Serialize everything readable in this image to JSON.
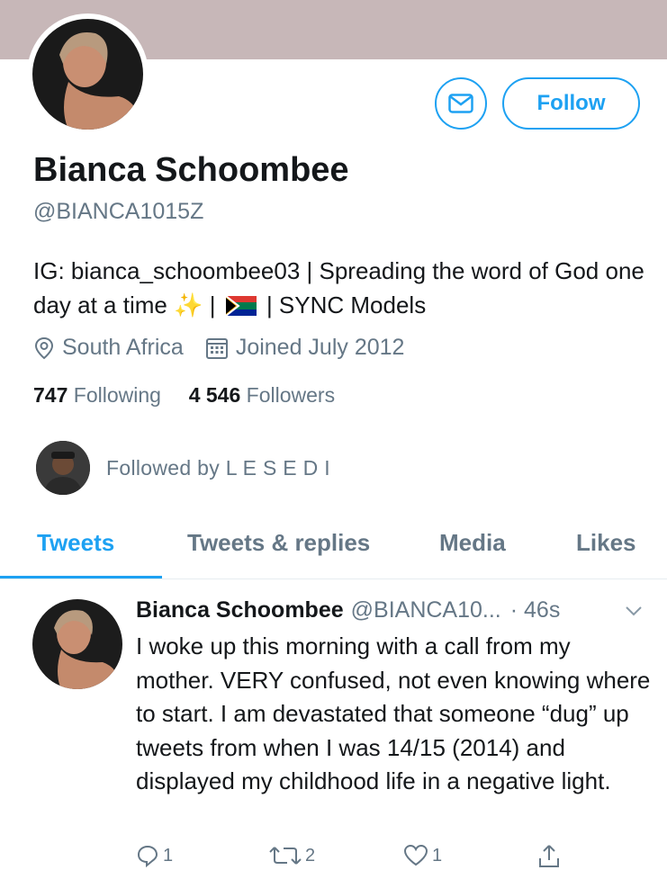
{
  "profile": {
    "display_name": "Bianca Schoombee",
    "handle": "@BIANCA1015Z",
    "bio_part1": "IG: bianca_schoombee03 | Spreading the word of God one day at a time",
    "bio_sparkle": "✨",
    "bio_sep1": "|",
    "bio_flag": "south-africa-flag",
    "bio_part2": "| SYNC Models",
    "location": "South Africa",
    "joined": "Joined July 2012",
    "following_count": "747",
    "following_label": "Following",
    "followers_count": "4 546",
    "followers_label": "Followers",
    "followed_by": "Followed by L E S E D I"
  },
  "buttons": {
    "follow_label": "Follow",
    "message_icon": "envelope-icon"
  },
  "tabs": [
    {
      "label": "Tweets",
      "active": true
    },
    {
      "label": "Tweets & replies",
      "active": false
    },
    {
      "label": "Media",
      "active": false
    },
    {
      "label": "Likes",
      "active": false
    }
  ],
  "tweet": {
    "author_name": "Bianca Schoombee",
    "author_handle": "@BIANCA10...",
    "time": "· 46s",
    "text": "I woke up this morning with a call from my mother. VERY confused, not even knowing where to start. I am devastated that someone “dug” up tweets from when I was 14/15 (2014) and displayed my childhood life in a negative light.",
    "reply_count": "1",
    "retweet_count": "2",
    "like_count": "1"
  },
  "colors": {
    "accent": "#1da1f2",
    "secondary_text": "#657786",
    "banner": "#c7b7b8"
  }
}
